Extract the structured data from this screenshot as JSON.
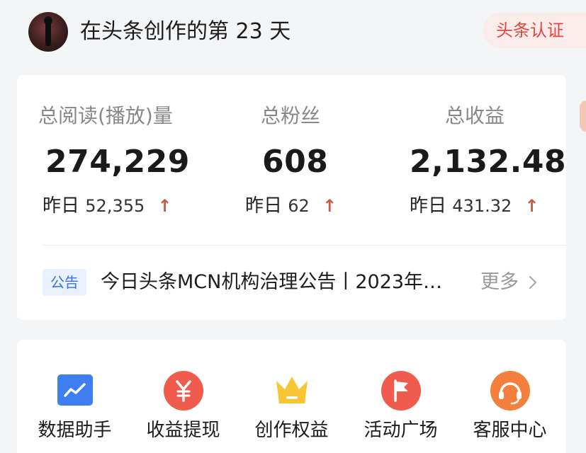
{
  "header": {
    "title": "在头条创作的第 23 天",
    "cert_label": "头条认证"
  },
  "stats": [
    {
      "label": "总阅读(播放)量",
      "value": "274,229",
      "delta_prefix": "昨日",
      "delta": "52,355",
      "trend": "up"
    },
    {
      "label": "总粉丝",
      "value": "608",
      "delta_prefix": "昨日",
      "delta": "62",
      "trend": "up"
    },
    {
      "label": "总收益",
      "value": "2,132.48",
      "delta_prefix": "昨日",
      "delta": "431.32",
      "trend": "up"
    }
  ],
  "notice": {
    "tag": "公告",
    "text": "今日头条MCN机构治理公告丨2023年…",
    "more": "更多"
  },
  "tools": [
    {
      "label": "数据助手",
      "icon": "chart-icon",
      "color": "#3e7ef0"
    },
    {
      "label": "收益提现",
      "icon": "yen-icon",
      "color": "#ef5b4c"
    },
    {
      "label": "创作权益",
      "icon": "crown-icon",
      "color": "#f7c634"
    },
    {
      "label": "活动广场",
      "icon": "flag-icon",
      "color": "#ef5b4c"
    },
    {
      "label": "客服中心",
      "icon": "headset-icon",
      "color": "#f3803d"
    }
  ],
  "colors": {
    "accent_red": "#e2473f",
    "trend_up": "#c85a48",
    "notice_blue": "#3a72d8"
  }
}
